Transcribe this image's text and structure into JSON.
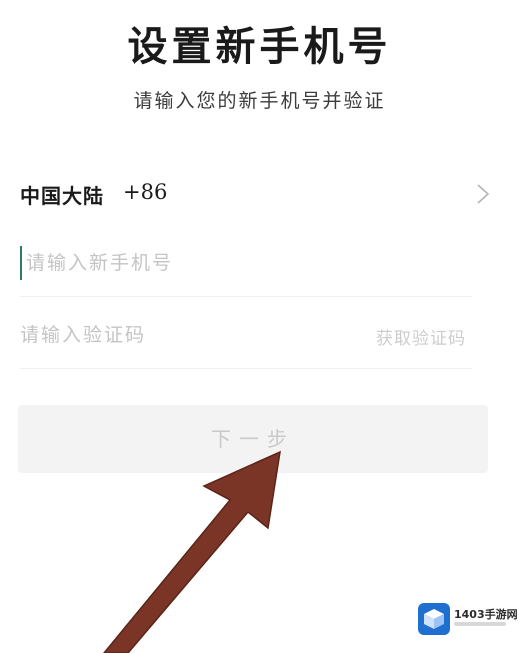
{
  "header": {
    "title": "设置新手机号",
    "subtitle": "请输入您的新手机号并验证"
  },
  "region": {
    "name": "中国大陆",
    "code": "+86",
    "icon": "chevron-right-icon"
  },
  "phone": {
    "value": "",
    "placeholder": "请输入新手机号"
  },
  "verification": {
    "value": "",
    "placeholder": "请输入验证码",
    "get_code_label": "获取验证码"
  },
  "next_button": {
    "label": "下一步"
  },
  "annotation": {
    "arrow_color": "#7a3526"
  },
  "watermark": {
    "text": "1403手游网"
  },
  "colors": {
    "cursor_accent": "#2e7d62",
    "disabled_text": "#c9c9c9",
    "button_bg": "#f3f3f3"
  }
}
